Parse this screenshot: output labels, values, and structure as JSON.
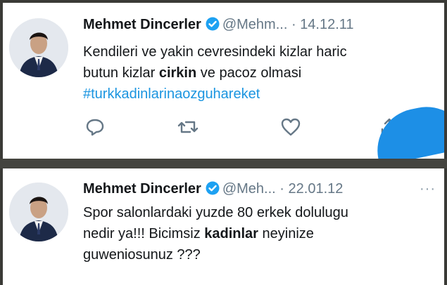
{
  "tweets": [
    {
      "author": "Mehmet Dincerler",
      "handle": "@Mehm...",
      "separator": "·",
      "date": "14.12.11",
      "text_parts": [
        "Kendileri ve yakin cevresindeki kizlar haric",
        "butun kizlar ",
        "cirkin",
        " ve pacoz olmasi"
      ],
      "hashtag": "#turkkadinlarinaozguhareket"
    },
    {
      "author": "Mehmet Dincerler",
      "handle": "@Meh...",
      "separator": "·",
      "date": "22.01.12",
      "more": "···",
      "text_parts": [
        "Spor salonlardaki yuzde 80 erkek dolulugu",
        "nedir ya!!! Bicimsiz ",
        "kadinlar",
        " neyinize",
        "guweniosunuz ???"
      ]
    }
  ],
  "colors": {
    "link": "#1b95e0",
    "verified": "#1da1f2",
    "muted": "#657786",
    "text": "#14171a"
  },
  "icons": [
    "verified-badge-icon",
    "reply-icon",
    "retweet-icon",
    "like-icon",
    "share-icon"
  ]
}
